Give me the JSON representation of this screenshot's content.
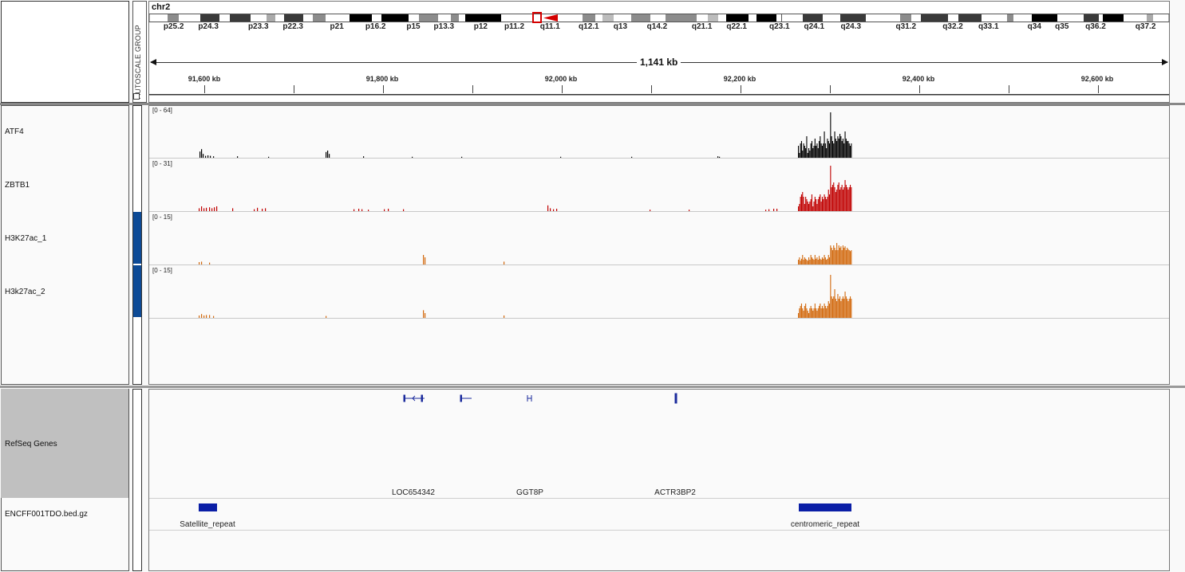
{
  "header": {
    "chromosome": "chr2",
    "autoscale_label": "AUTOSCALE GROUP",
    "span_label": "1,141 kb",
    "bands": [
      {
        "name": "p25.2",
        "at": 0.024
      },
      {
        "name": "p24.3",
        "at": 0.058
      },
      {
        "name": "p23.3",
        "at": 0.107
      },
      {
        "name": "p22.3",
        "at": 0.141
      },
      {
        "name": "p21",
        "at": 0.184
      },
      {
        "name": "p16.2",
        "at": 0.222
      },
      {
        "name": "p15",
        "at": 0.259
      },
      {
        "name": "p13.3",
        "at": 0.289
      },
      {
        "name": "p12",
        "at": 0.325
      },
      {
        "name": "p11.2",
        "at": 0.358
      },
      {
        "name": "q11.1",
        "at": 0.393
      },
      {
        "name": "q12.1",
        "at": 0.431
      },
      {
        "name": "q13",
        "at": 0.462
      },
      {
        "name": "q14.2",
        "at": 0.498
      },
      {
        "name": "q21.1",
        "at": 0.542
      },
      {
        "name": "q22.1",
        "at": 0.576
      },
      {
        "name": "q23.1",
        "at": 0.618
      },
      {
        "name": "q24.1",
        "at": 0.652
      },
      {
        "name": "q24.3",
        "at": 0.688
      },
      {
        "name": "q31.2",
        "at": 0.742
      },
      {
        "name": "q32.2",
        "at": 0.788
      },
      {
        "name": "q33.1",
        "at": 0.823
      },
      {
        "name": "q34",
        "at": 0.868
      },
      {
        "name": "q35",
        "at": 0.895
      },
      {
        "name": "q36.2",
        "at": 0.928
      },
      {
        "name": "q37.2",
        "at": 0.977
      }
    ],
    "ticks": [
      "91,600 kb",
      "91,800 kb",
      "92,000 kb",
      "92,200 kb",
      "92,400 kb",
      "92,600 kb"
    ]
  },
  "tracks": [
    {
      "name": "ATF4",
      "range": "[0 - 64]",
      "color": "#000000"
    },
    {
      "name": "ZBTB1",
      "range": "[0 - 31]",
      "color": "#c00000"
    },
    {
      "name": "H3K27ac_1",
      "range": "[0 - 15]",
      "color": "#d2690e"
    },
    {
      "name": "H3k27ac_2",
      "range": "[0 - 15]",
      "color": "#d2690e"
    }
  ],
  "features": {
    "refseq_name": "RefSeq Genes",
    "bed_name": "ENCFF001TDO.bed.gz",
    "genes": [
      "LOC654342",
      "GGT8P",
      "ACTR3BP2"
    ],
    "bed_items": [
      "Satellite_repeat",
      "centromeric_repeat"
    ],
    "gene_color": "#1a2a9c"
  },
  "colors": {
    "attribute_fill": "#0d4a96",
    "centromere": "#d40000"
  }
}
